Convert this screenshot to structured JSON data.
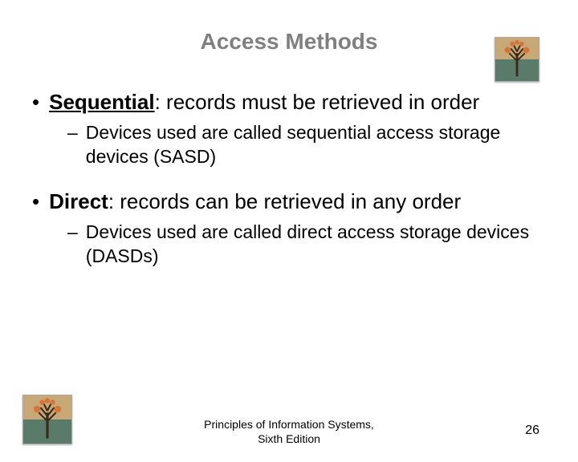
{
  "title": "Access Methods",
  "bullets": [
    {
      "term": "Sequential",
      "rest": ": records must be retrieved in order",
      "sub": "Devices used are called sequential access storage devices (SASD)"
    },
    {
      "term": "Direct",
      "rest": ": records can be retrieved in any order",
      "sub": "Devices used are called direct access storage devices (DASDs)"
    }
  ],
  "footer_line1": "Principles of Information Systems,",
  "footer_line2": "Sixth Edition",
  "page_number": "26"
}
